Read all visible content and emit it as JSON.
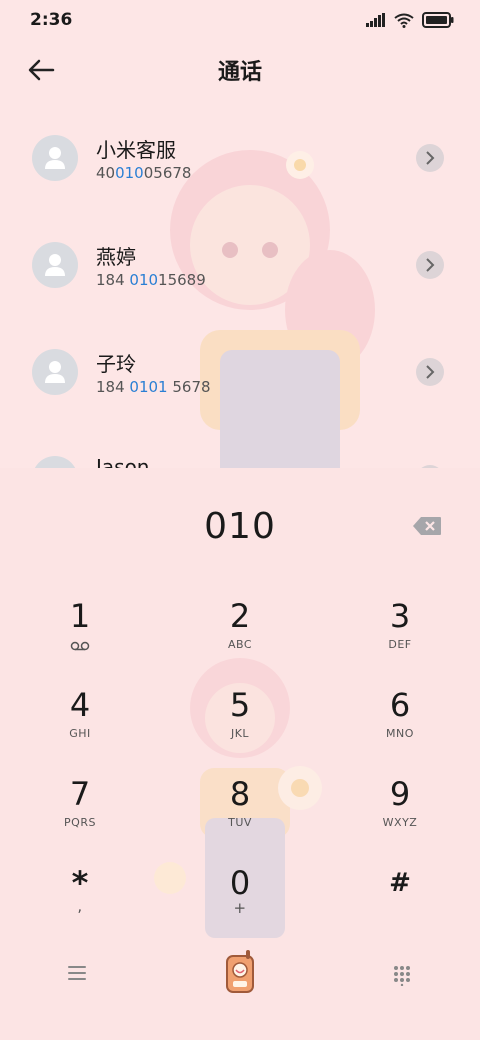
{
  "status_bar": {
    "time": "2:36"
  },
  "header": {
    "title": "通话"
  },
  "contacts": [
    {
      "name": "小米客服",
      "number_pre": "40",
      "number_hl": "010",
      "number_post": "05678"
    },
    {
      "name": "燕婷",
      "number_pre": "184 ",
      "number_hl": "010",
      "number_post": "15689"
    },
    {
      "name": "子玲",
      "number_pre": "184 ",
      "number_hl": "0101",
      "number_post": " 5678"
    },
    {
      "name": "Jason",
      "number_pre": "",
      "number_hl": "",
      "number_post": ""
    }
  ],
  "dialer": {
    "input": "010",
    "keys": [
      {
        "digit": "1",
        "letters": ""
      },
      {
        "digit": "2",
        "letters": "ABC"
      },
      {
        "digit": "3",
        "letters": "DEF"
      },
      {
        "digit": "4",
        "letters": "GHI"
      },
      {
        "digit": "5",
        "letters": "JKL"
      },
      {
        "digit": "6",
        "letters": "MNO"
      },
      {
        "digit": "7",
        "letters": "PQRS"
      },
      {
        "digit": "8",
        "letters": "TUV"
      },
      {
        "digit": "9",
        "letters": "WXYZ"
      },
      {
        "digit": "*",
        "letters": ","
      },
      {
        "digit": "0",
        "letters": "+"
      },
      {
        "digit": "#",
        "letters": ""
      }
    ]
  },
  "colors": {
    "background": "#fde6e6",
    "highlight": "#2a7fd4",
    "call_button": "#f0a070"
  },
  "icons": [
    "back-arrow-icon",
    "person-icon",
    "chevron-right-icon",
    "backspace-icon",
    "voicemail-icon",
    "menu-icon",
    "call-icon",
    "dialpad-icon"
  ]
}
